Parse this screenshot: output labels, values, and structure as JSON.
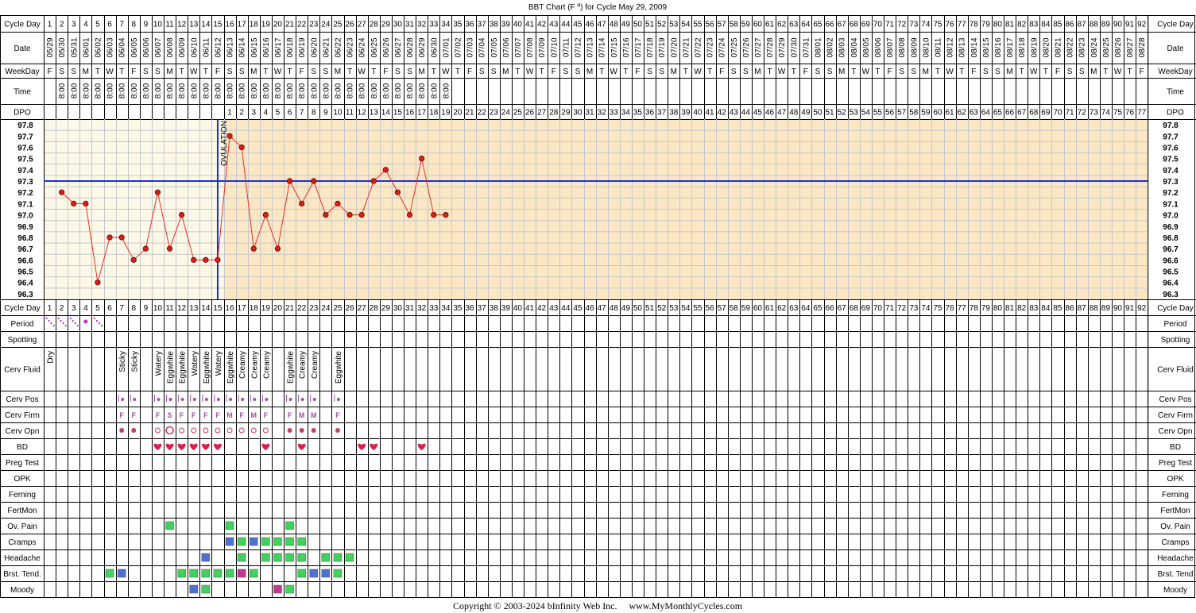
{
  "title": "BBT Chart (F º) for Cycle May 29, 2009",
  "copyright": "Copyright © 2003-2024 bInfinity Web Inc.     www.MyMonthlyCycles.com",
  "ovulation_label": "OVULATION",
  "row_labels": {
    "cycle_day": "Cycle Day",
    "date": "Date",
    "weekday": "WeekDay",
    "time": "Time",
    "dpo": "DPO",
    "period": "Period",
    "spotting": "Spotting",
    "cerv_fluid": "Cerv Fluid",
    "cerv_pos": "Cerv Pos",
    "cerv_firm": "Cerv Firm",
    "cerv_opn": "Cerv Opn",
    "bd": "BD",
    "preg_test": "Preg Test",
    "opk": "OPK",
    "ferning": "Ferning",
    "fertmon": "FertMon",
    "ov_pain": "Ov. Pain",
    "cramps": "Cramps",
    "headache": "Headache",
    "brst_tend_left": "Brst. Tend.",
    "brst_tend_right": "Brst. Tend",
    "moody": "Moody"
  },
  "colors": {
    "pre_ovulation_bg": "#fbf8e8",
    "post_ovulation_bg": "#fbe7c4",
    "grid": "#c8c8c8",
    "coverline": "#1f2fd0",
    "temp_line": "#e8302a",
    "temp_point": "#d8201a",
    "period_dot": "#c030c0",
    "heart": "#d8204a",
    "sym_green": "#44d060",
    "sym_blue": "#5070d0",
    "sym_magenta": "#c03890",
    "cerv_mark": "#a050a0",
    "opn_mark": "#c04060"
  },
  "dates": [
    "05/29",
    "05/30",
    "05/31",
    "06/01",
    "06/02",
    "06/03",
    "06/04",
    "06/05",
    "06/06",
    "06/07",
    "06/08",
    "06/09",
    "06/10",
    "06/11",
    "06/12",
    "06/13",
    "06/14",
    "06/15",
    "06/16",
    "06/17",
    "06/18",
    "06/19",
    "06/20",
    "06/21",
    "06/22",
    "06/23",
    "06/24",
    "06/25",
    "06/26",
    "06/27",
    "06/28",
    "06/29",
    "06/30",
    "07/01",
    "07/02",
    "07/03",
    "07/04",
    "07/05",
    "07/06",
    "07/07",
    "07/08",
    "07/09",
    "07/10",
    "07/11",
    "07/12",
    "07/13",
    "07/14",
    "07/15",
    "07/16",
    "07/17",
    "07/18",
    "07/19",
    "07/20",
    "07/21",
    "07/22",
    "07/23",
    "07/24",
    "07/25",
    "07/26",
    "07/27",
    "07/28",
    "07/29",
    "07/30",
    "07/31",
    "08/01",
    "08/02",
    "08/03",
    "08/04",
    "08/05",
    "08/06",
    "08/07",
    "08/08",
    "08/09",
    "08/10",
    "08/11",
    "08/12",
    "08/13",
    "08/14",
    "08/15",
    "08/16",
    "08/17",
    "08/18",
    "08/19",
    "08/20",
    "08/21",
    "08/22",
    "08/23",
    "08/24",
    "08/25",
    "08/26",
    "08/27",
    "08/28"
  ],
  "weekdays": [
    "F",
    "S",
    "S",
    "M",
    "T",
    "W",
    "T",
    "F",
    "S",
    "S",
    "M",
    "T",
    "W",
    "T",
    "F",
    "S",
    "S",
    "M",
    "T",
    "W",
    "T",
    "F",
    "S",
    "S",
    "M",
    "T",
    "W",
    "T",
    "F",
    "S",
    "S",
    "M",
    "T",
    "W",
    "T",
    "F",
    "S",
    "S",
    "M",
    "T",
    "W",
    "T",
    "F",
    "S",
    "S",
    "M",
    "T",
    "W",
    "T",
    "F",
    "S",
    "S",
    "M",
    "T",
    "W",
    "T",
    "F",
    "S",
    "S",
    "M",
    "T",
    "W",
    "T",
    "F",
    "S",
    "S",
    "M",
    "T",
    "W",
    "T",
    "F",
    "S",
    "S",
    "M",
    "T",
    "W",
    "T",
    "F",
    "S",
    "S",
    "M",
    "T",
    "W",
    "T",
    "F",
    "S",
    "S",
    "M",
    "T",
    "W",
    "T",
    "F"
  ],
  "time_value": "8:00",
  "dpo_start_day": 16,
  "chart_data": {
    "type": "line",
    "title": "BBT Chart (F º) for Cycle May 29, 2009",
    "x": [
      2,
      3,
      4,
      5,
      6,
      7,
      8,
      9,
      10,
      11,
      12,
      13,
      14,
      15,
      16,
      17,
      18,
      19,
      20,
      21,
      22,
      23,
      24,
      25,
      26,
      27,
      28,
      29,
      30,
      31,
      32,
      33,
      34
    ],
    "y": [
      97.2,
      97.1,
      97.1,
      96.4,
      96.8,
      96.8,
      96.6,
      96.7,
      97.2,
      96.7,
      97.0,
      96.6,
      96.6,
      96.6,
      97.7,
      97.6,
      96.7,
      97.0,
      96.7,
      97.3,
      97.1,
      97.3,
      97.0,
      97.1,
      97.0,
      97.0,
      97.3,
      97.4,
      97.2,
      97.0,
      97.5,
      97.0,
      97.0
    ],
    "xlabel": "Cycle Day",
    "ylabel": "",
    "xlim": [
      1,
      92
    ],
    "ylim": [
      96.3,
      97.8
    ],
    "yticks": [
      "97.8",
      "97.7",
      "97.6",
      "97.5",
      "97.4",
      "97.3",
      "97.2",
      "97.1",
      "97.0",
      "96.9",
      "96.8",
      "96.7",
      "96.6",
      "96.5",
      "96.4",
      "96.3"
    ],
    "coverline": 97.3,
    "ovulation_day": 15,
    "grid": true
  },
  "time_days": [
    2,
    34
  ],
  "period_days": [
    1,
    2,
    3,
    4,
    5
  ],
  "cerv_fluid": [
    {
      "day": 1,
      "text": "Dry"
    },
    {
      "day": 7,
      "text": "Sticky"
    },
    {
      "day": 8,
      "text": "Sticky"
    },
    {
      "day": 10,
      "text": "Watery"
    },
    {
      "day": 11,
      "text": "Eggwhite"
    },
    {
      "day": 12,
      "text": "Eggwhite"
    },
    {
      "day": 13,
      "text": "Watery"
    },
    {
      "day": 14,
      "text": "Eggwhite"
    },
    {
      "day": 15,
      "text": "Watery"
    },
    {
      "day": 16,
      "text": "Eggwhite"
    },
    {
      "day": 17,
      "text": "Creamy"
    },
    {
      "day": 18,
      "text": "Creamy"
    },
    {
      "day": 19,
      "text": "Creamy"
    },
    {
      "day": 21,
      "text": "Eggwhite"
    },
    {
      "day": 22,
      "text": "Creamy"
    },
    {
      "day": 23,
      "text": "Creamy"
    },
    {
      "day": 25,
      "text": "Eggwhite"
    }
  ],
  "cerv_pos_days": [
    7,
    8,
    10,
    11,
    12,
    13,
    14,
    15,
    16,
    17,
    18,
    19,
    21,
    22,
    23,
    25
  ],
  "cerv_firm": [
    {
      "day": 7,
      "text": "F"
    },
    {
      "day": 8,
      "text": "F"
    },
    {
      "day": 10,
      "text": "F"
    },
    {
      "day": 11,
      "text": "S"
    },
    {
      "day": 12,
      "text": "F"
    },
    {
      "day": 13,
      "text": "F"
    },
    {
      "day": 14,
      "text": "F"
    },
    {
      "day": 15,
      "text": "F"
    },
    {
      "day": 16,
      "text": "M"
    },
    {
      "day": 17,
      "text": "F"
    },
    {
      "day": 18,
      "text": "M"
    },
    {
      "day": 19,
      "text": "F"
    },
    {
      "day": 21,
      "text": "F"
    },
    {
      "day": 22,
      "text": "M"
    },
    {
      "day": 23,
      "text": "M"
    },
    {
      "day": 25,
      "text": "F"
    }
  ],
  "cerv_opn": [
    {
      "day": 7,
      "kind": "closed"
    },
    {
      "day": 8,
      "kind": "closed"
    },
    {
      "day": 10,
      "kind": "medium"
    },
    {
      "day": 11,
      "kind": "open"
    },
    {
      "day": 12,
      "kind": "medium"
    },
    {
      "day": 13,
      "kind": "medium"
    },
    {
      "day": 14,
      "kind": "medium"
    },
    {
      "day": 15,
      "kind": "medium"
    },
    {
      "day": 16,
      "kind": "medium"
    },
    {
      "day": 17,
      "kind": "medium"
    },
    {
      "day": 18,
      "kind": "medium"
    },
    {
      "day": 19,
      "kind": "medium"
    },
    {
      "day": 21,
      "kind": "closed"
    },
    {
      "day": 22,
      "kind": "closed"
    },
    {
      "day": 23,
      "kind": "closed"
    },
    {
      "day": 25,
      "kind": "closed"
    }
  ],
  "bd_days": [
    10,
    11,
    12,
    13,
    14,
    15,
    19,
    22,
    27,
    28,
    32
  ],
  "ov_pain": [
    {
      "day": 11,
      "c": "green"
    },
    {
      "day": 16,
      "c": "green"
    },
    {
      "day": 21,
      "c": "green"
    }
  ],
  "cramps": [
    {
      "day": 16,
      "c": "blue"
    },
    {
      "day": 17,
      "c": "green"
    },
    {
      "day": 18,
      "c": "blue"
    },
    {
      "day": 19,
      "c": "green"
    },
    {
      "day": 20,
      "c": "green"
    },
    {
      "day": 21,
      "c": "green"
    },
    {
      "day": 22,
      "c": "green"
    }
  ],
  "headache": [
    {
      "day": 14,
      "c": "blue"
    },
    {
      "day": 17,
      "c": "green"
    },
    {
      "day": 19,
      "c": "green"
    },
    {
      "day": 20,
      "c": "green"
    },
    {
      "day": 21,
      "c": "green"
    },
    {
      "day": 22,
      "c": "green"
    },
    {
      "day": 24,
      "c": "green"
    },
    {
      "day": 25,
      "c": "green"
    },
    {
      "day": 26,
      "c": "green"
    }
  ],
  "brst_tend": [
    {
      "day": 6,
      "c": "green"
    },
    {
      "day": 7,
      "c": "blue"
    },
    {
      "day": 12,
      "c": "green"
    },
    {
      "day": 13,
      "c": "green"
    },
    {
      "day": 14,
      "c": "green"
    },
    {
      "day": 15,
      "c": "green"
    },
    {
      "day": 16,
      "c": "green"
    },
    {
      "day": 17,
      "c": "magenta"
    },
    {
      "day": 18,
      "c": "green"
    },
    {
      "day": 22,
      "c": "green"
    },
    {
      "day": 23,
      "c": "blue"
    },
    {
      "day": 24,
      "c": "blue"
    },
    {
      "day": 25,
      "c": "green"
    }
  ],
  "moody": [
    {
      "day": 13,
      "c": "blue"
    },
    {
      "day": 14,
      "c": "green"
    },
    {
      "day": 20,
      "c": "magenta"
    },
    {
      "day": 21,
      "c": "green"
    }
  ]
}
